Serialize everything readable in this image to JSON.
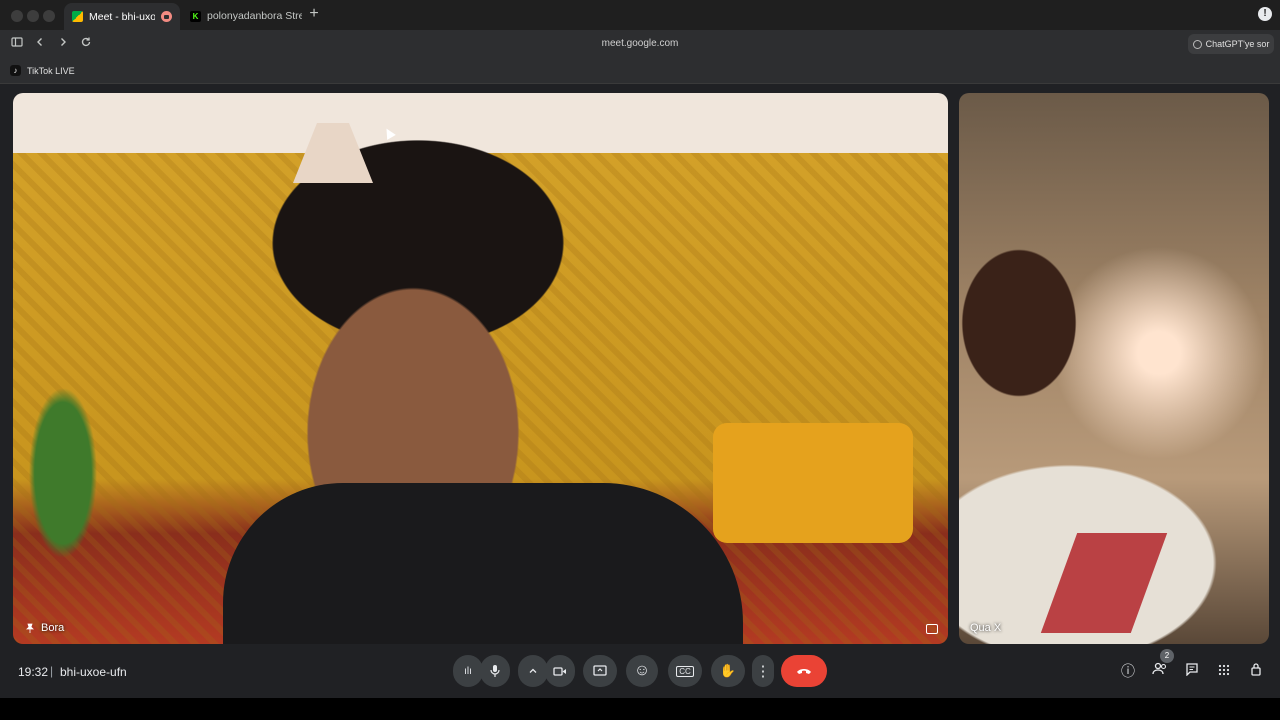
{
  "browser": {
    "tabs": [
      {
        "title": "Meet - bhi-uxoe-",
        "favicon": "meet-icon",
        "recording": true,
        "active": true
      },
      {
        "title": "polonyadanbora Stre",
        "favicon": "kick-icon",
        "active": false
      }
    ],
    "new_tab_glyph": "+",
    "profile_glyph": "!",
    "url": "meet.google.com",
    "chatgpt_label": "ChatGPT'ye sor",
    "bookmarks": [
      {
        "label": "TikTok LIVE",
        "icon": "tiktok-icon"
      }
    ],
    "kick_letter": "K"
  },
  "meet": {
    "participants": [
      {
        "name": "Bora",
        "pinned": true
      },
      {
        "name": "Qua X",
        "pinned": false
      }
    ],
    "time": "19:32",
    "separator": "|",
    "meeting_code": "bhi-uxoe-ufn",
    "people_count": "2",
    "controls": {
      "audio_levels": "ılı",
      "mic": "🎙",
      "caret": "^",
      "camera": "▭",
      "present": "▣",
      "emoji": "☺",
      "captions": "CC",
      "raise_hand": "✋",
      "more": "⋮",
      "hangup": "☎"
    },
    "right_icons": {
      "info": "ⓘ",
      "people": "👥",
      "chat": "💬",
      "activities": "⋮⋮⋮",
      "host": "🔒"
    },
    "colors": {
      "hangup": "#ea4335",
      "control_bg": "#3c4043",
      "background": "#202124"
    }
  }
}
